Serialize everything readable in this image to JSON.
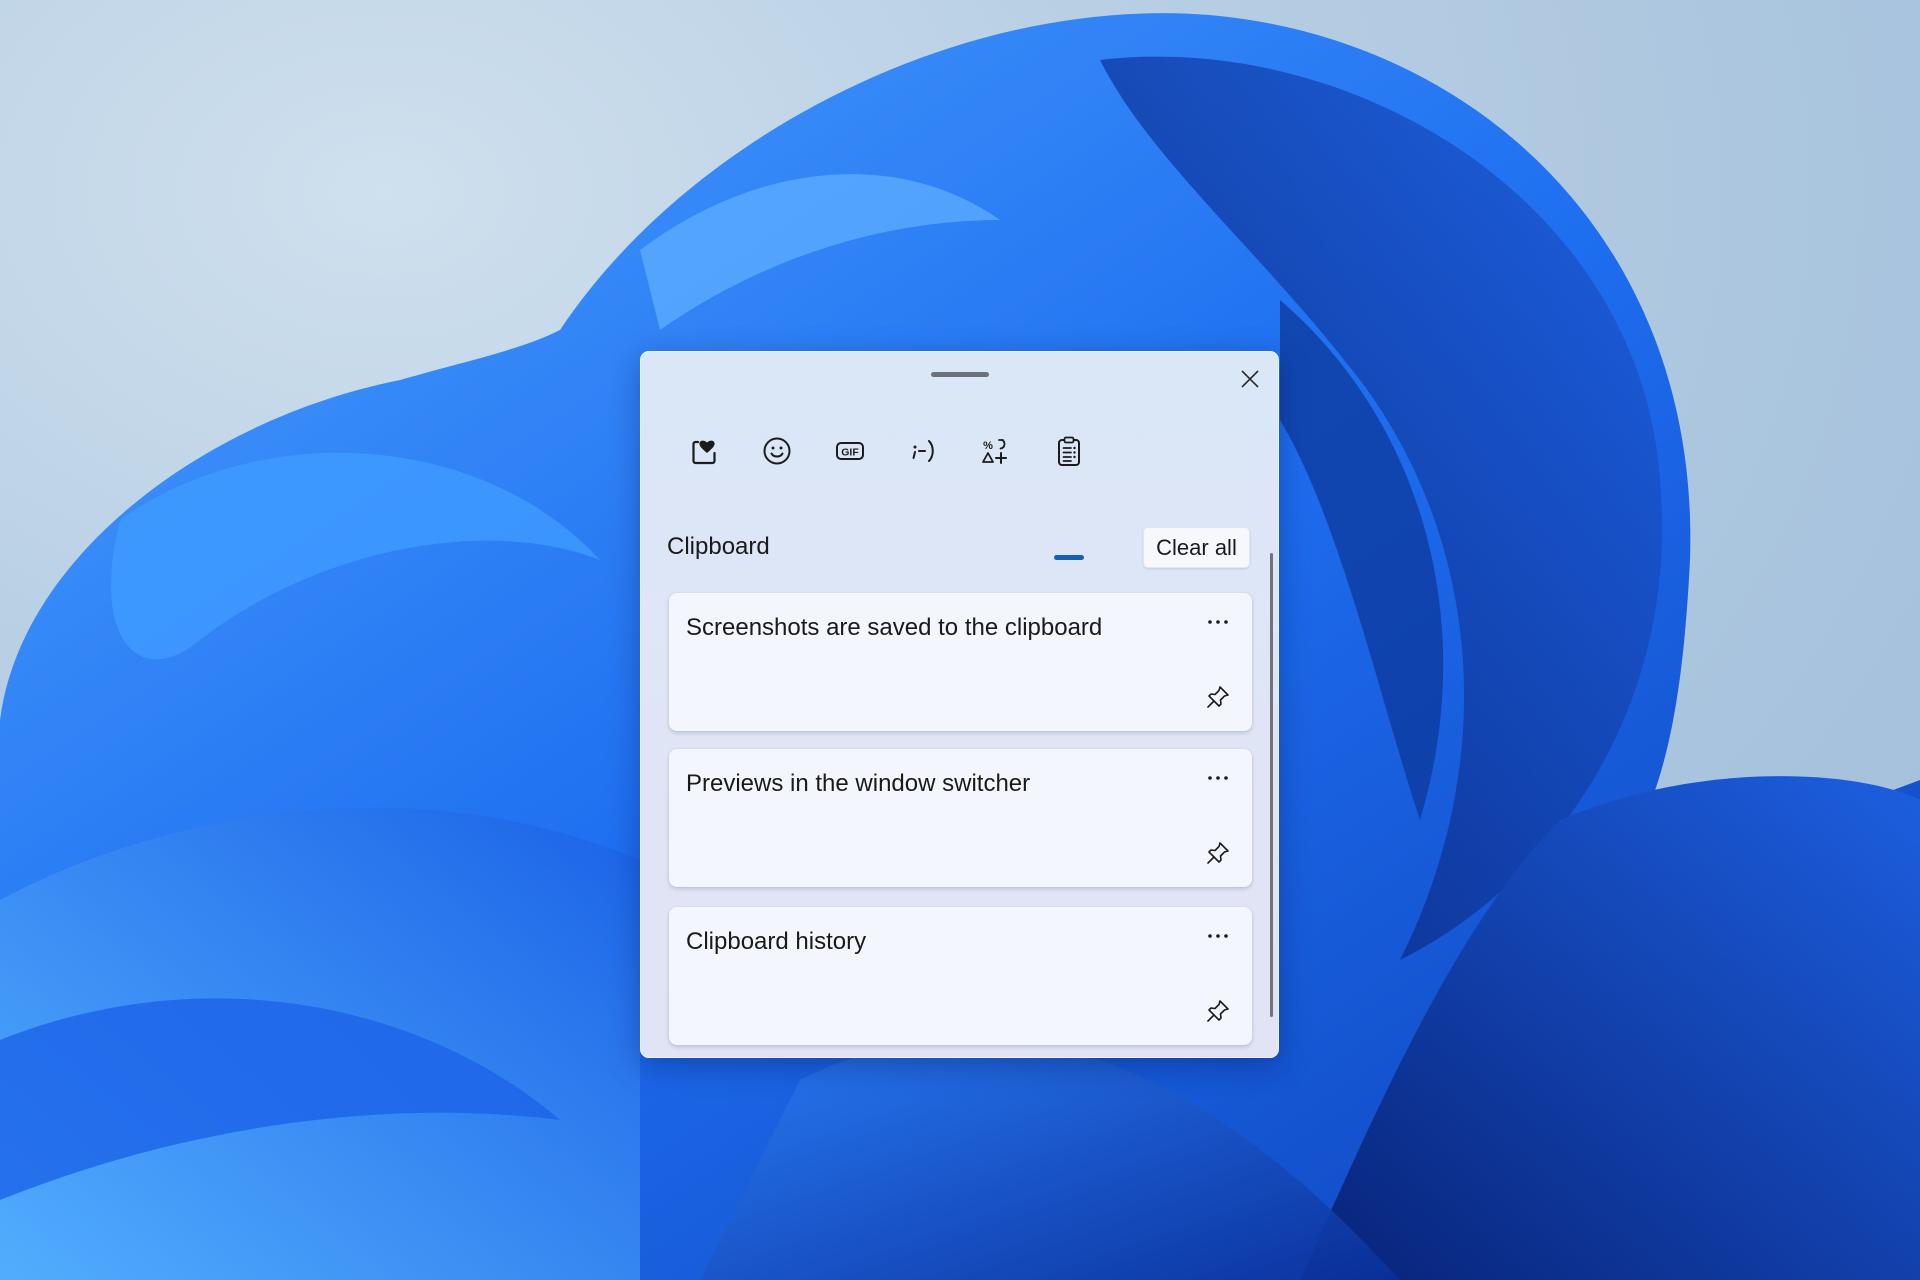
{
  "desktop": {
    "wallpaper": "windows-11-bloom",
    "colors": {
      "sky": "#b8cfe4",
      "bloom_light": "#3b8cf5",
      "bloom_mid": "#1f62e0",
      "bloom_dark": "#0b2a8a"
    }
  },
  "panel": {
    "title": "Clipboard",
    "close_label": "Close",
    "tabs": [
      {
        "id": "kaomoji-favorites",
        "label": "Most recently used",
        "icon": "heart-box-icon",
        "active": false
      },
      {
        "id": "emoji",
        "label": "Emoji",
        "icon": "smiley-icon",
        "active": false
      },
      {
        "id": "gif",
        "label": "GIF",
        "icon": "gif-icon",
        "active": false
      },
      {
        "id": "kaomoji",
        "label": "Kaomoji",
        "icon": "kaomoji-icon",
        "active": false,
        "glyph": ";-)"
      },
      {
        "id": "symbols",
        "label": "Symbols",
        "icon": "symbols-icon",
        "active": false
      },
      {
        "id": "clipboard",
        "label": "Clipboard history",
        "icon": "clipboard-icon",
        "active": true
      }
    ],
    "accent_color": "#1360b8",
    "clear_all_label": "Clear all",
    "items": [
      {
        "text": "Screenshots are saved to the clipboard",
        "more_label": "See more",
        "pin_label": "Pin"
      },
      {
        "text": "Previews in the window switcher",
        "more_label": "See more",
        "pin_label": "Pin"
      },
      {
        "text": "Clipboard history",
        "more_label": "See more",
        "pin_label": "Pin"
      }
    ]
  }
}
